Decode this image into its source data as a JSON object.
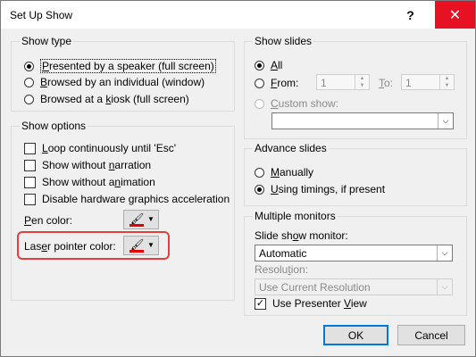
{
  "window": {
    "title": "Set Up Show",
    "help_glyph": "?",
    "close_glyph": "✕"
  },
  "show_type": {
    "title": "Show type",
    "options": [
      {
        "pre": "",
        "ul": "P",
        "post": "resented by a speaker (full screen)",
        "selected": true
      },
      {
        "pre": "",
        "ul": "B",
        "post": "rowsed by an individual (window)",
        "selected": false
      },
      {
        "pre": "Browsed at a ",
        "ul": "k",
        "post": "iosk (full screen)",
        "selected": false
      }
    ]
  },
  "show_options": {
    "title": "Show options",
    "checks": [
      {
        "pre": "",
        "ul": "L",
        "post": "oop continuously until 'Esc'",
        "checked": false
      },
      {
        "pre": "Show without ",
        "ul": "n",
        "post": "arration",
        "checked": false
      },
      {
        "pre": "Show without a",
        "ul": "n",
        "post": "imation",
        "checked": false
      },
      {
        "pre": "Disable hardware ",
        "ul": "g",
        "post": "raphics acceleration",
        "checked": false
      }
    ],
    "pen_color": {
      "pre": "",
      "ul": "P",
      "post": "en color:"
    },
    "laser_color": {
      "pre": "Las",
      "ul": "e",
      "post": "r pointer color:"
    }
  },
  "show_slides": {
    "title": "Show slides",
    "all": {
      "ul": "A",
      "post": "ll",
      "selected": true
    },
    "from": {
      "ul": "F",
      "post": "rom:",
      "value": "1"
    },
    "to": {
      "ul": "T",
      "post": "o:",
      "value": "1"
    },
    "custom": {
      "ul": "C",
      "post": "ustom show:"
    }
  },
  "advance_slides": {
    "title": "Advance slides",
    "manual": {
      "ul": "M",
      "post": "anually",
      "selected": false
    },
    "timings": {
      "ul": "U",
      "post": "sing timings, if present",
      "selected": true
    }
  },
  "monitors": {
    "title": "Multiple monitors",
    "monitor_label": {
      "pre": "Slide sh",
      "ul": "o",
      "post": "w monitor:"
    },
    "monitor_value": "Automatic",
    "resolution_label": {
      "pre": "Resolu",
      "ul": "t",
      "post": "ion:"
    },
    "resolution_value": "Use Current Resolution",
    "presenter_view": {
      "pre": "Use Presenter ",
      "ul": "V",
      "post": "iew",
      "checked": true
    }
  },
  "buttons": {
    "ok": "OK",
    "cancel": "Cancel"
  },
  "colors": {
    "close_red": "#e81123",
    "pen_red": "#e00000",
    "highlight": "#e04040"
  }
}
